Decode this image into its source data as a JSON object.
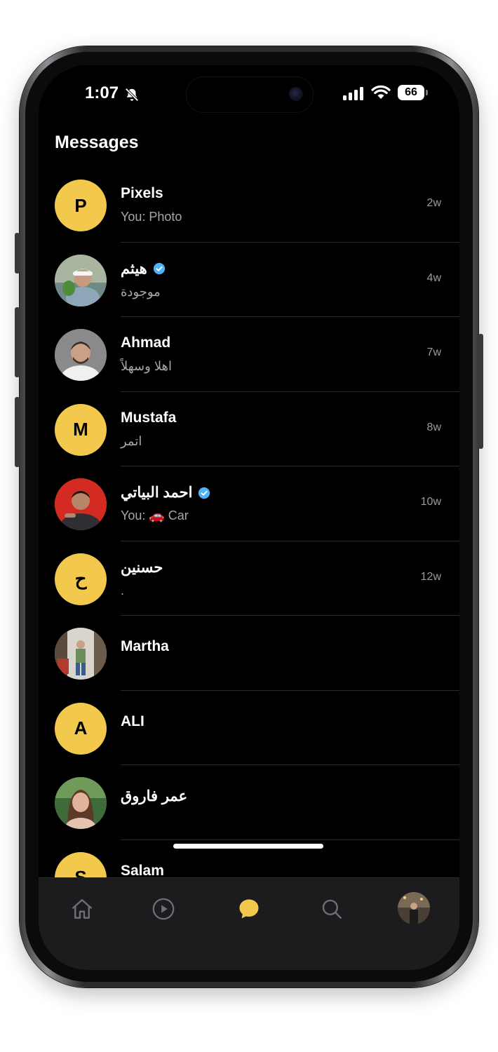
{
  "status_bar": {
    "time": "1:07",
    "battery": "66"
  },
  "header": {
    "title": "Messages"
  },
  "conversations": [
    {
      "avatar_letter": "P",
      "name": "Pixels",
      "verified": false,
      "preview": "You: Photo",
      "age": "2w"
    },
    {
      "avatar_letter": "",
      "name": "هيثم",
      "verified": true,
      "preview": "موجودة",
      "age": "4w"
    },
    {
      "avatar_letter": "",
      "name": "Ahmad",
      "verified": false,
      "preview": "اهلا وسهلاً",
      "age": "7w"
    },
    {
      "avatar_letter": "M",
      "name": "Mustafa",
      "verified": false,
      "preview": "اتمر",
      "age": "8w"
    },
    {
      "avatar_letter": "",
      "name": "احمد البياتي",
      "verified": true,
      "preview": "You: 🚗 Car",
      "age": "10w"
    },
    {
      "avatar_letter": "ح",
      "name": "حسنين",
      "verified": false,
      "preview": ".",
      "age": "12w"
    },
    {
      "avatar_letter": "",
      "name": "Martha",
      "verified": false,
      "preview": "",
      "age": ""
    },
    {
      "avatar_letter": "A",
      "name": "ALI",
      "verified": false,
      "preview": "",
      "age": ""
    },
    {
      "avatar_letter": "",
      "name": "عمر فاروق",
      "verified": false,
      "preview": "",
      "age": ""
    },
    {
      "avatar_letter": "S",
      "name": "Salam",
      "verified": false,
      "preview": "",
      "age": ""
    }
  ],
  "tab_bar": {
    "tabs": [
      {
        "icon": "home-icon",
        "active": false
      },
      {
        "icon": "play-icon",
        "active": false
      },
      {
        "icon": "chat-bubble-icon",
        "active": true
      },
      {
        "icon": "search-icon",
        "active": false
      },
      {
        "icon": "profile-avatar",
        "active": false
      }
    ]
  },
  "colors": {
    "accent": "#f2c94c",
    "verified": "#4fb3f6",
    "background": "#000000"
  }
}
